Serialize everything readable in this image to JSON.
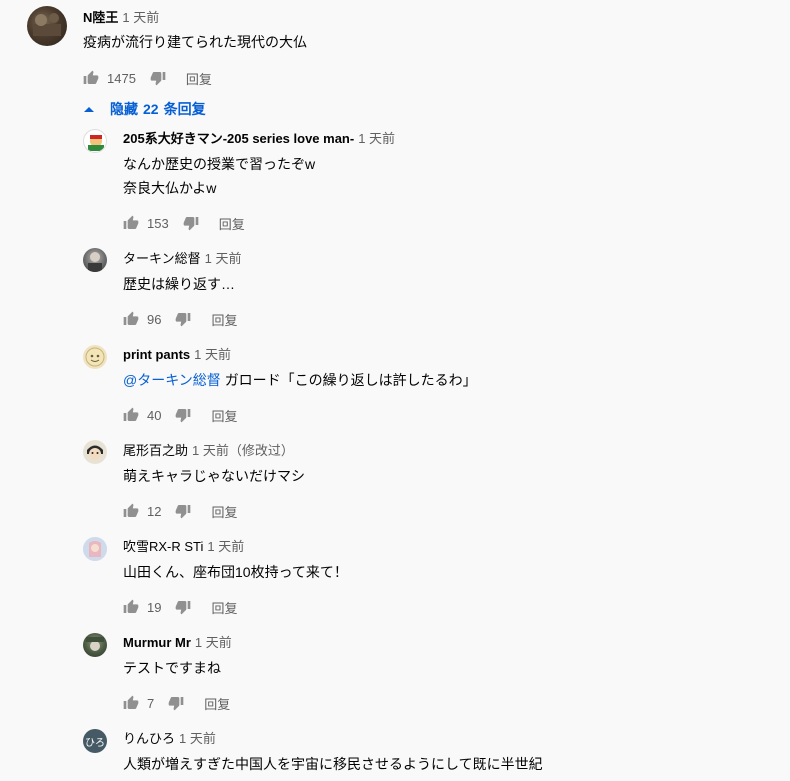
{
  "top_comment": {
    "author": "N陸王",
    "time": "1 天前",
    "text": "疫病が流行り建てられた現代の大仏",
    "likes": "1475",
    "reply_label": "回复"
  },
  "hide_replies": {
    "prefix": "隐藏",
    "count": "22",
    "suffix": "条回复"
  },
  "replies": [
    {
      "author": "205系大好きマン-205 series love man-",
      "time": "1 天前",
      "lines": [
        "なんか歴史の授業で習ったぞw",
        "奈良大仏かよw"
      ],
      "likes": "153",
      "reply_label": "回复"
    },
    {
      "author": "ターキン総督",
      "time": "1 天前",
      "lines": [
        "歴史は繰り返す…"
      ],
      "likes": "96",
      "reply_label": "回复"
    },
    {
      "author": "print pants",
      "time": "1 天前",
      "mention": "@ターキン総督",
      "lines": [
        "ガロード「この繰り返しは許したるわ」"
      ],
      "likes": "40",
      "reply_label": "回复"
    },
    {
      "author": "尾形百之助",
      "time": "1 天前（修改过）",
      "lines": [
        "萌えキャラじゃないだけマシ"
      ],
      "likes": "12",
      "reply_label": "回复"
    },
    {
      "author": "吹雪RX-R STi",
      "time": "1 天前",
      "lines": [
        "山田くん、座布団10枚持って来て！"
      ],
      "likes": "19",
      "reply_label": "回复"
    },
    {
      "author": "Murmur Mr",
      "time": "1 天前",
      "lines": [
        "テストですまね"
      ],
      "likes": "7",
      "reply_label": "回复"
    },
    {
      "author": "りんひろ",
      "time": "1 天前",
      "avatar_text": "ひろ",
      "lines": [
        "人類が増えすぎた中国人を宇宙に移民させるようにして既に半世紀"
      ]
    }
  ],
  "colors": {
    "link": "#065fd4",
    "secondary_text": "#606060",
    "background": "#f9f9f9"
  },
  "icons": [
    "thumb-up-icon",
    "thumb-down-icon",
    "caret-up-icon"
  ]
}
